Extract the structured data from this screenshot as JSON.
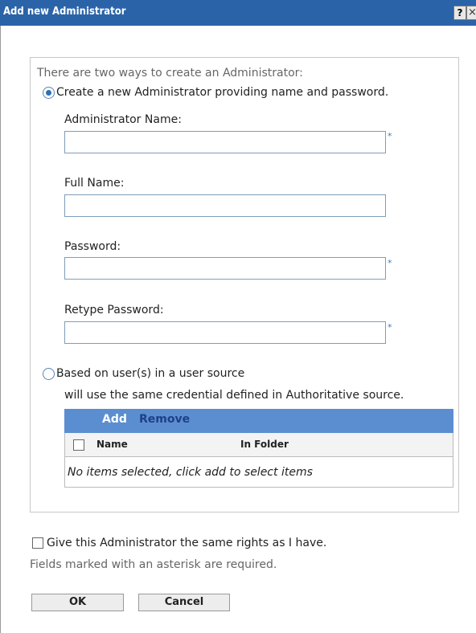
{
  "window": {
    "title": "Add new Administrator",
    "help_icon": "?",
    "close_icon": "×"
  },
  "form": {
    "intro": "There are two ways to create an Administrator:",
    "option_create": "Create a new Administrator providing name and password.",
    "option_create_selected": true,
    "admin_name_label": "Administrator Name:",
    "admin_name_value": "",
    "full_name_label": "Full Name:",
    "full_name_value": "",
    "password_label": "Password:",
    "password_value": "",
    "retype_password_label": "Retype Password:",
    "retype_password_value": "",
    "required_marker": "*",
    "option_source": "Based on user(s) in a user source",
    "option_source_selected": false,
    "option_source_note": "will use the same credential defined in Authoritative source.",
    "table": {
      "add_label": "Add",
      "remove_label": "Remove",
      "columns": [
        "Name",
        "In Folder"
      ],
      "empty_message": "No items selected, click add to select items"
    },
    "same_rights_label": "Give this Administrator the same rights as I have.",
    "same_rights_checked": false,
    "required_note": "Fields marked with an asterisk are required."
  },
  "buttons": {
    "ok": "OK",
    "cancel": "Cancel"
  },
  "colors": {
    "title_bar": "#2a63a8",
    "table_header": "#5b8ed0",
    "accent_asterisk": "#3a7cc7"
  }
}
